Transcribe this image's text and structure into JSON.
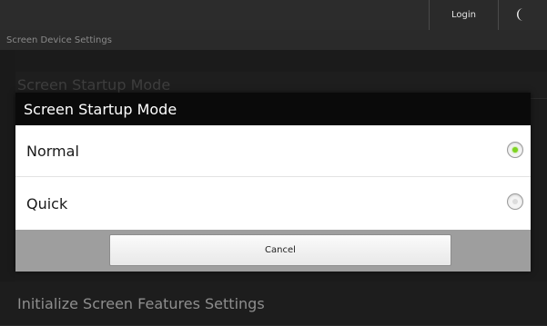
{
  "topbar": {
    "login_label": "Login",
    "mode_icon": "moon-icon"
  },
  "header": {
    "title": "Screen Device Settings"
  },
  "background_list": {
    "items": [
      {
        "label": "Screen Startup Mode"
      },
      {
        "label": "Initialize Screen Features Settings"
      }
    ]
  },
  "dialog": {
    "title": "Screen Startup Mode",
    "options": [
      {
        "label": "Normal",
        "selected": true
      },
      {
        "label": "Quick",
        "selected": false
      }
    ],
    "cancel_label": "Cancel"
  },
  "colors": {
    "accent_selected": "#7ed321",
    "dialog_title_bg": "#0a0a0a",
    "footer_bg": "#9e9e9e"
  }
}
